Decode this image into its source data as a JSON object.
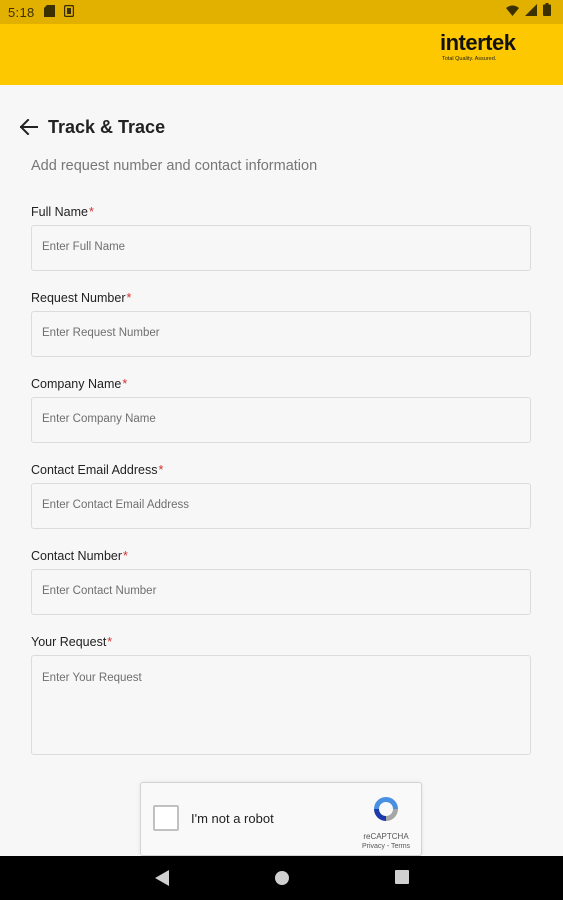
{
  "status_bar": {
    "time": "5:18"
  },
  "brand": {
    "name": "intertek",
    "tagline": "Total Quality. Assured."
  },
  "header": {
    "title": "Track & Trace"
  },
  "subtitle": "Add request number and contact information",
  "required_marker": "*",
  "form": {
    "full_name": {
      "label": "Full Name",
      "placeholder": "Enter Full Name"
    },
    "request_number": {
      "label": "Request Number",
      "placeholder": "Enter Request Number"
    },
    "company_name": {
      "label": "Company Name",
      "placeholder": "Enter Company Name"
    },
    "contact_email": {
      "label": "Contact Email Address",
      "placeholder": "Enter Contact Email Address"
    },
    "contact_number": {
      "label": "Contact Number",
      "placeholder": "Enter Contact Number"
    },
    "your_request": {
      "label": "Your Request",
      "placeholder": "Enter Your Request"
    }
  },
  "captcha": {
    "label": "I'm not a robot",
    "brand": "reCAPTCHA",
    "links": "Privacy - Terms"
  },
  "colors": {
    "brand_yellow": "#fdc800",
    "status_bar": "#e2b100",
    "required": "#d32f2f"
  }
}
